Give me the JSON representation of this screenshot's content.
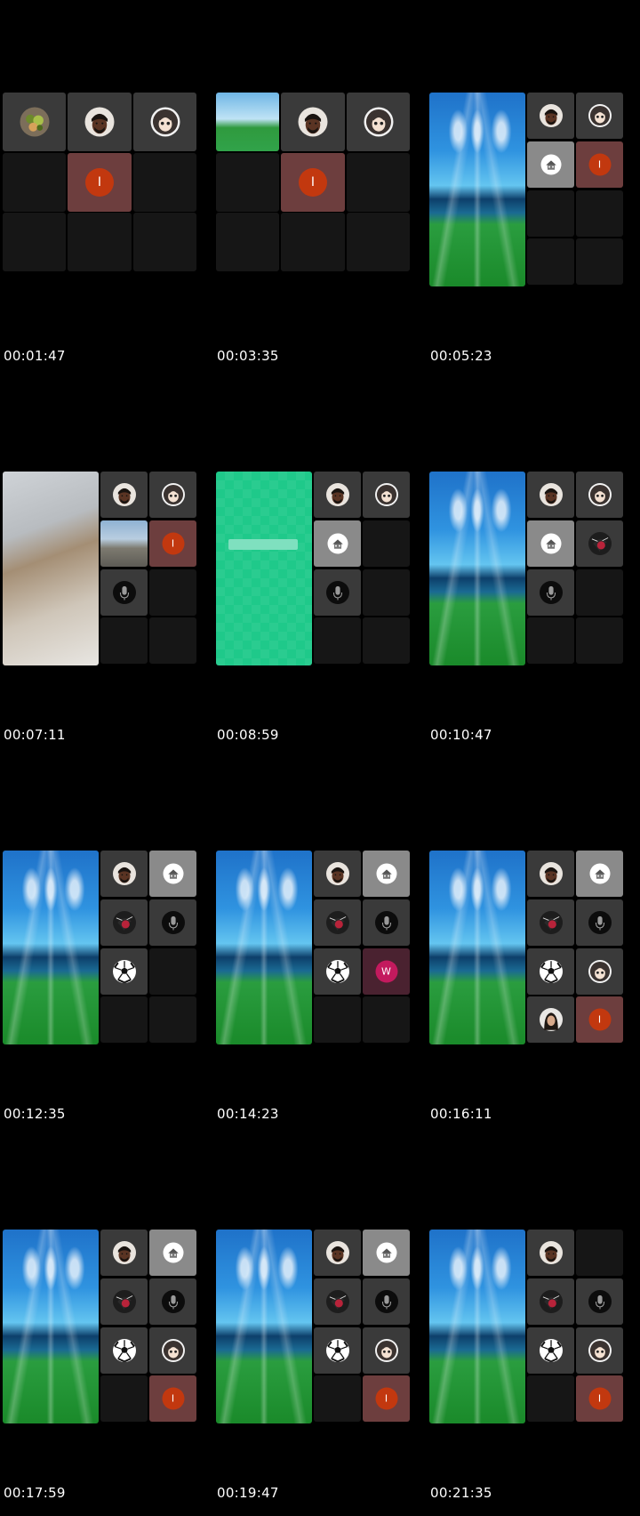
{
  "timestamps": [
    "00:01:47",
    "00:03:35",
    "00:05:23",
    "00:07:11",
    "00:08:59",
    "00:10:47",
    "00:12:35",
    "00:14:23",
    "00:16:11",
    "00:17:59",
    "00:19:47",
    "00:21:35"
  ],
  "initials": {
    "red_participant": "I",
    "pink_participant": "W"
  },
  "colors": {
    "background": "#000000",
    "red_avatar": "#c2380f",
    "pink_avatar": "#c31a5e",
    "stadium_green": "#1a8a2a",
    "app_green": "#1fc98a"
  },
  "icons": [
    "salad-photo-icon",
    "man-avatar-icon",
    "girl-cartoon-avatar-icon",
    "house-icon",
    "microphone-icon",
    "dark-rose-avatar-icon",
    "soccer-ball-icon",
    "woman-avatar-icon"
  ]
}
